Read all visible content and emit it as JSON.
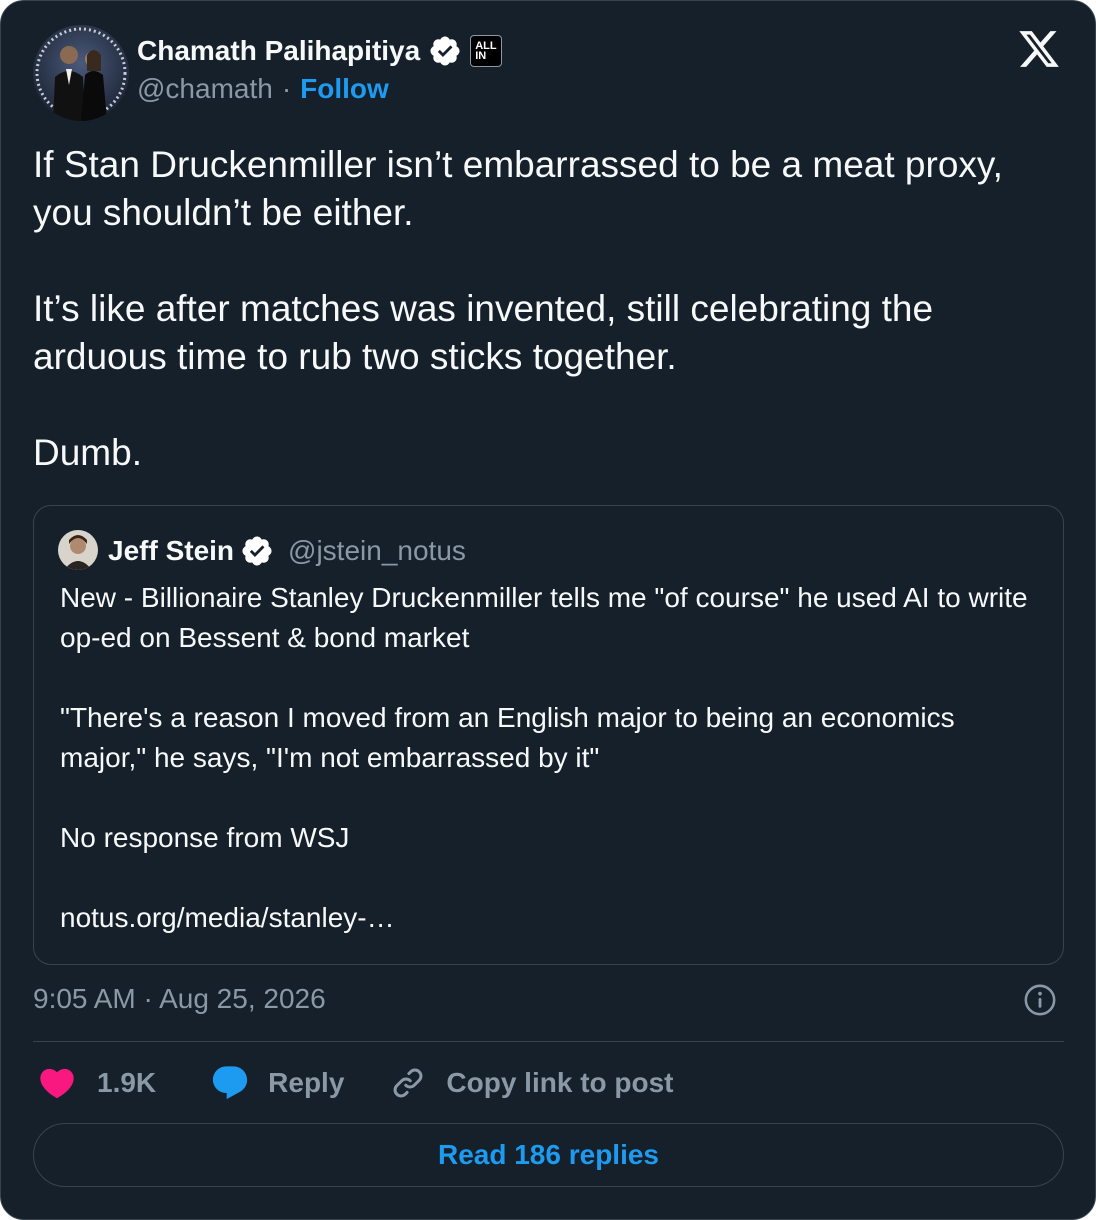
{
  "author": {
    "name": "Chamath Palihapitiya",
    "handle": "@chamath",
    "follow_label": "Follow",
    "affiliation_badge": "ALL IN"
  },
  "post": {
    "text": "If Stan Druckenmiller isn’t embarrassed to be a meat proxy, you shouldn’t be either.\n\nIt’s like after matches was invented, still celebrating the arduous time to rub two sticks together.\n\nDumb.",
    "timestamp": "9:05 AM · Aug 25, 2026"
  },
  "quoted_post": {
    "name": "Jeff Stein",
    "handle": "@jstein_notus",
    "text": "New - Billionaire Stanley Druckenmiller tells me \"of course\" he used AI to write op-ed on Bessent & bond market\n\n\"There's a reason I moved from an English major to being an economics major,\" he says, \"I'm not embarrassed by it\"\n\nNo response from WSJ\n\nnotus.org/media/stanley-…"
  },
  "actions": {
    "like_count": "1.9K",
    "reply_label": "Reply",
    "copy_link_label": "Copy link to post",
    "read_replies_label": "Read 186 replies"
  },
  "colors": {
    "background": "#15202b",
    "border": "#38444d",
    "text_primary": "#f7f9f9",
    "text_secondary": "#8b98a5",
    "accent": "#1d9bf0",
    "like": "#f91880"
  },
  "icons": [
    "verified-badge-icon",
    "affiliate-badge-icon",
    "x-logo-icon",
    "info-icon",
    "heart-icon",
    "reply-bubble-icon",
    "link-icon"
  ]
}
